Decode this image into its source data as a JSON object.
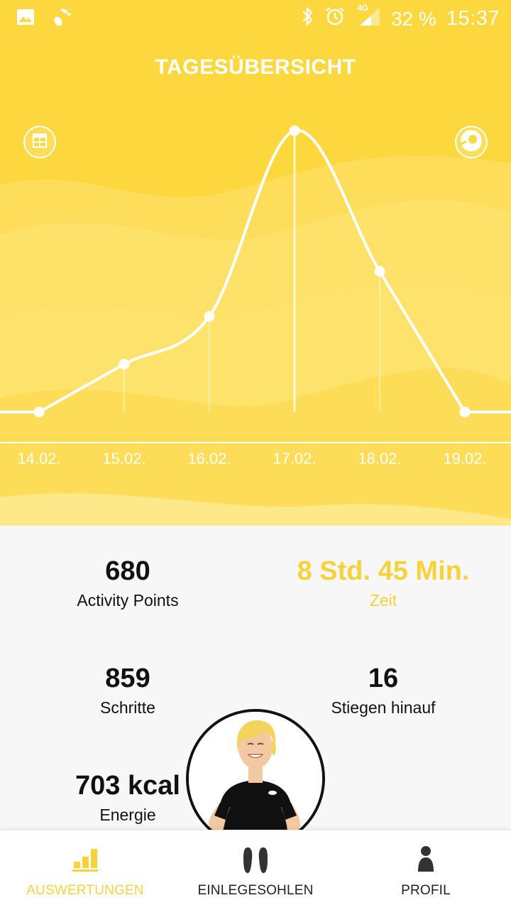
{
  "status_bar": {
    "left_icons": [
      "image-icon",
      "footprint-icon"
    ],
    "right_icons": [
      "bluetooth-icon",
      "alarm-icon",
      "signal-4g-icon"
    ],
    "network": "4G",
    "battery": "32 %",
    "time": "15:37"
  },
  "header": {
    "title": "TAGESÜBERSICHT",
    "left_button_icon": "calendar-grid-icon",
    "right_button_icon": "target-icon",
    "color": "#fcd73e"
  },
  "chart_data": {
    "type": "line",
    "categories": [
      "14.02.",
      "15.02.",
      "16.02.",
      "17.02.",
      "18.02.",
      "19.02."
    ],
    "values": [
      0,
      17,
      34,
      100,
      50,
      0
    ],
    "highlighted": "17.02.",
    "grid": false
  },
  "stats": {
    "activity_points": {
      "value": "680",
      "label": "Activity Points"
    },
    "time": {
      "value": "8 Std. 45 Min.",
      "label": "Zeit"
    },
    "steps": {
      "value": "859",
      "label": "Schritte"
    },
    "stairs": {
      "value": "16",
      "label": "Stiegen hinauf"
    },
    "energy": {
      "value": "703 kcal",
      "label": "Energie"
    }
  },
  "accent_color": "#f7d23b",
  "nav": {
    "items": [
      {
        "label": "AUSWERTUNGEN",
        "icon": "bar-chart-icon",
        "active": true
      },
      {
        "label": "EINLEGESOHLEN",
        "icon": "insoles-icon",
        "active": false
      },
      {
        "label": "PROFIL",
        "icon": "person-icon",
        "active": false
      }
    ]
  }
}
